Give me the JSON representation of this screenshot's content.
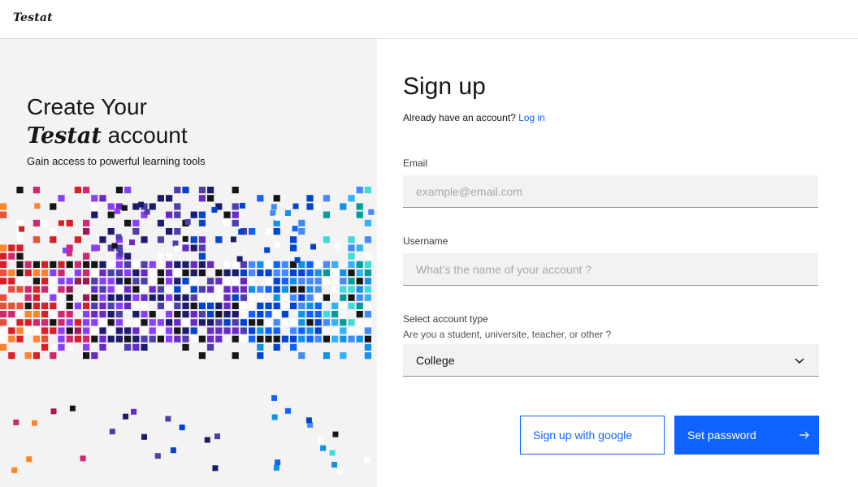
{
  "app": {
    "logo": "Testat"
  },
  "hero": {
    "line1": "Create Your",
    "brand": "Testat",
    "line2_suffix": " account",
    "subtitle": "Gain access to powerful learning tools"
  },
  "form": {
    "title": "Sign up",
    "login_prompt": "Already have an account?",
    "login_link": "Log in",
    "email": {
      "label": "Email",
      "placeholder": "example@email.com",
      "value": ""
    },
    "username": {
      "label": "Username",
      "placeholder": "What’s the name of your account ?",
      "value": ""
    },
    "account_type": {
      "label": "Select account type",
      "helper": "Are you a student, universite, teacher, or other ?",
      "selected": "College",
      "icon": "chevron-down-icon"
    },
    "google_button": "Sign up with google",
    "submit_button": "Set password",
    "submit_icon": "arrow-right-icon"
  },
  "colors": {
    "accent": "#0f62fe",
    "panel_bg": "#f3f3f3",
    "input_bg": "#f2f2f2",
    "pixel_palette": [
      "#da1e28",
      "#e8503a",
      "#ff832b",
      "#d12771",
      "#9f1853",
      "#8a3ffc",
      "#6929c4",
      "#4e3fa8",
      "#1c1c6b",
      "#0043ce",
      "#0f62fe",
      "#4589ff",
      "#1192e8",
      "#33b1ff",
      "#3ddbd9",
      "#009d9a",
      "#161616"
    ]
  }
}
